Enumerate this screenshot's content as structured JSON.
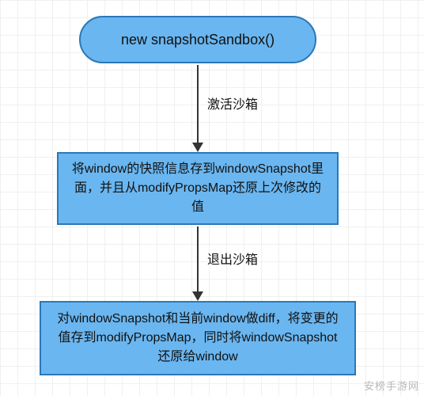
{
  "nodes": {
    "start": {
      "label": "new snapshotSandbox()"
    },
    "step1": {
      "label": "将window的快照信息存到windowSnapshot里面，并且从modifyPropsMap还原上次修改的值"
    },
    "step2": {
      "label": "对windowSnapshot和当前window做diff，将变更的值存到modifyPropsMap，同时将windowSnapshot还原给window"
    }
  },
  "edges": {
    "e1": {
      "label": "激活沙箱"
    },
    "e2": {
      "label": "退出沙箱"
    }
  },
  "watermark": "安榜手游网",
  "colors": {
    "node_fill": "#6ab6f0",
    "node_border": "#2b78b8",
    "arrow": "#333333"
  }
}
